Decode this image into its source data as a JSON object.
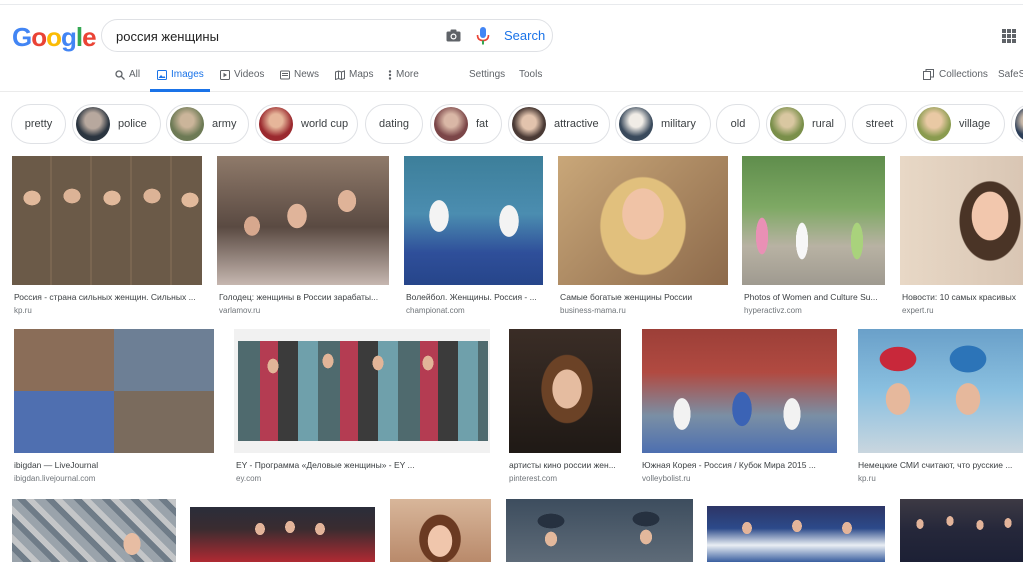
{
  "header": {
    "logo": [
      "G",
      "o",
      "o",
      "g",
      "l",
      "e"
    ],
    "logo_colors": [
      "#4285F4",
      "#EA4335",
      "#FBBC05",
      "#4285F4",
      "#34A853",
      "#EA4335"
    ],
    "query": "россия женщины",
    "search_label": "Search"
  },
  "tabs": {
    "all": "All",
    "images": "Images",
    "videos": "Videos",
    "news": "News",
    "maps": "Maps",
    "more": "More",
    "settings": "Settings",
    "tools": "Tools",
    "collections": "Collections",
    "safesearch": "SafeS"
  },
  "chips": [
    {
      "label": "pretty",
      "thumb": false
    },
    {
      "label": "police",
      "thumb": true
    },
    {
      "label": "army",
      "thumb": true
    },
    {
      "label": "world cup",
      "thumb": true
    },
    {
      "label": "dating",
      "thumb": false
    },
    {
      "label": "fat",
      "thumb": true
    },
    {
      "label": "attractive",
      "thumb": true
    },
    {
      "label": "military",
      "thumb": true
    },
    {
      "label": "old",
      "thumb": false
    },
    {
      "label": "rural",
      "thumb": true
    },
    {
      "label": "street",
      "thumb": false
    },
    {
      "label": "village",
      "thumb": true
    }
  ],
  "results_row1": [
    {
      "caption": "Россия - страна сильных женщин. Сильных ...",
      "source": "kp.ru"
    },
    {
      "caption": "Голодец: женщины в России зарабаты...",
      "source": "varlamov.ru"
    },
    {
      "caption": "Волейбол. Женщины. Россия - ...",
      "source": "championat.com"
    },
    {
      "caption": "Самые богатые женщины России",
      "source": "business-mama.ru"
    },
    {
      "caption": "Photos of Women and Culture Su...",
      "source": "hyperactivz.com"
    },
    {
      "caption": "Новости: 10 самых красивых",
      "source": "expert.ru"
    }
  ],
  "results_row2": [
    {
      "caption": "ibigdan — LiveJournal",
      "source": "ibigdan.livejournal.com"
    },
    {
      "caption": "EY - Программа «Деловые женщины» - EY ...",
      "source": "ey.com"
    },
    {
      "caption": "артисты кино россии жен...",
      "source": "pinterest.com"
    },
    {
      "caption": "Южная Корея - Россия / Кубок Мира 2015 ...",
      "source": "volleybolist.ru"
    },
    {
      "caption": "Немецкие СМИ считают, что русские ...",
      "source": "kp.ru"
    }
  ]
}
